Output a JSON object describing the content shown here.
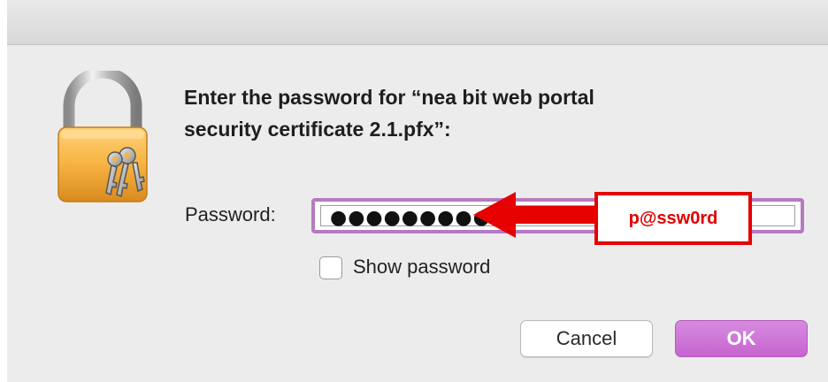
{
  "dialog": {
    "prompt_line1": "Enter the password for “nea bit web portal",
    "prompt_line2": "security certificate 2.1.pfx”:",
    "password_label": "Password:",
    "password_masked": "●●●●●●●●●",
    "annotation_text": "p@ssw0rd",
    "show_password_label": "Show password",
    "show_password_checked": false,
    "cancel_label": "Cancel",
    "ok_label": "OK"
  },
  "icons": {
    "lock": "keychain-lock-icon",
    "arrow": "red-arrow-left"
  },
  "colors": {
    "focus_ring": "#b57ac0",
    "ok_button": "#c664cf",
    "annotation": "#e60000",
    "lock_body": "#f2a93b"
  }
}
